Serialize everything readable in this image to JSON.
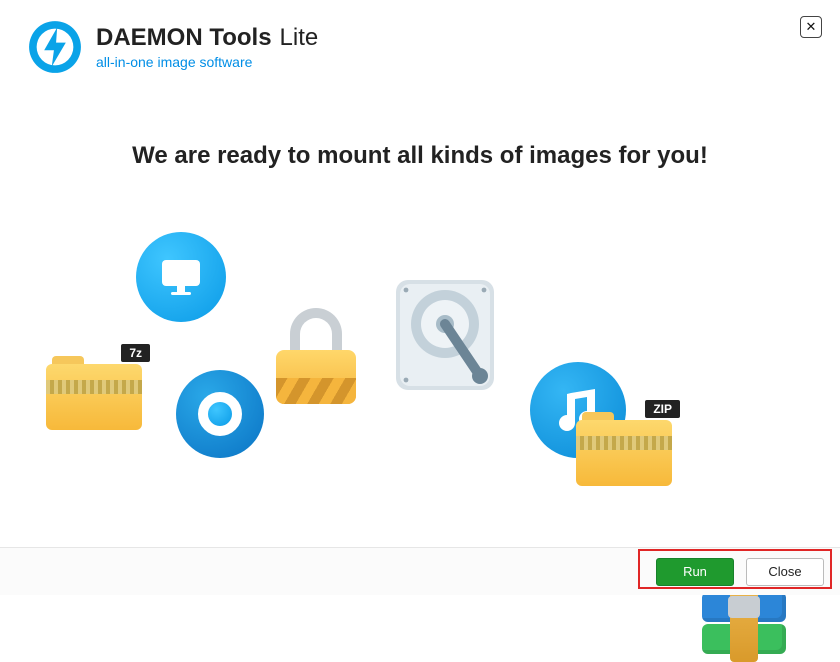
{
  "header": {
    "title_strong": "DAEMON Tools",
    "title_light": "Lite",
    "subtitle": "all-in-one image software"
  },
  "headline": "We are ready to mount all kinds of images for you!",
  "icons": {
    "folder_7z_badge": "7z",
    "folder_zip_badge": "ZIP"
  },
  "footer": {
    "run_label": "Run",
    "close_label": "Close"
  },
  "window": {
    "close_glyph": "✕"
  }
}
